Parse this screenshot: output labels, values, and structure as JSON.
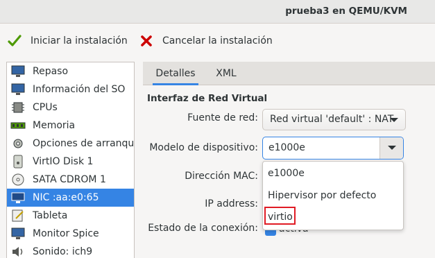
{
  "window": {
    "title": "prueba3 en QEMU/KVM"
  },
  "toolbar": {
    "start_label": "Iniciar la instalación",
    "cancel_label": "Cancelar la instalación"
  },
  "sidebar": {
    "items": [
      {
        "label": "Repaso",
        "icon": "monitor-icon"
      },
      {
        "label": "Información del SO",
        "icon": "monitor-icon"
      },
      {
        "label": "CPUs",
        "icon": "cpu-icon"
      },
      {
        "label": "Memoria",
        "icon": "memory-icon"
      },
      {
        "label": "Opciones de arranque",
        "icon": "gear-icon"
      },
      {
        "label": "VirtIO Disk 1",
        "icon": "disk-icon"
      },
      {
        "label": "SATA CDROM 1",
        "icon": "cdrom-icon"
      },
      {
        "label": "NIC :aa:e0:65",
        "icon": "network-icon",
        "selected": true
      },
      {
        "label": "Tableta",
        "icon": "tablet-icon"
      },
      {
        "label": "Monitor Spice",
        "icon": "monitor-icon"
      },
      {
        "label": "Sonido: ich9",
        "icon": "speaker-icon"
      }
    ]
  },
  "tabs": {
    "details": "Detalles",
    "xml": "XML"
  },
  "nic": {
    "section_title": "Interfaz de Red Virtual",
    "source_label": "Fuente de red:",
    "source_value": "Red virtual 'default' : NAT",
    "model_label": "Modelo de dispositivo:",
    "model_value": "e1000e",
    "mac_label": "Dirección MAC:",
    "ip_label": "IP address:",
    "link_label": "Estado de la conexión:",
    "link_value": "activa",
    "model_options": [
      "e1000e",
      "Hipervisor por defecto",
      "virtio"
    ],
    "highlighted_option": "virtio"
  },
  "colors": {
    "accent": "#3584e4",
    "highlight_box": "#e01b24",
    "check_green": "#4e9a06",
    "cancel_red": "#cc0000"
  }
}
